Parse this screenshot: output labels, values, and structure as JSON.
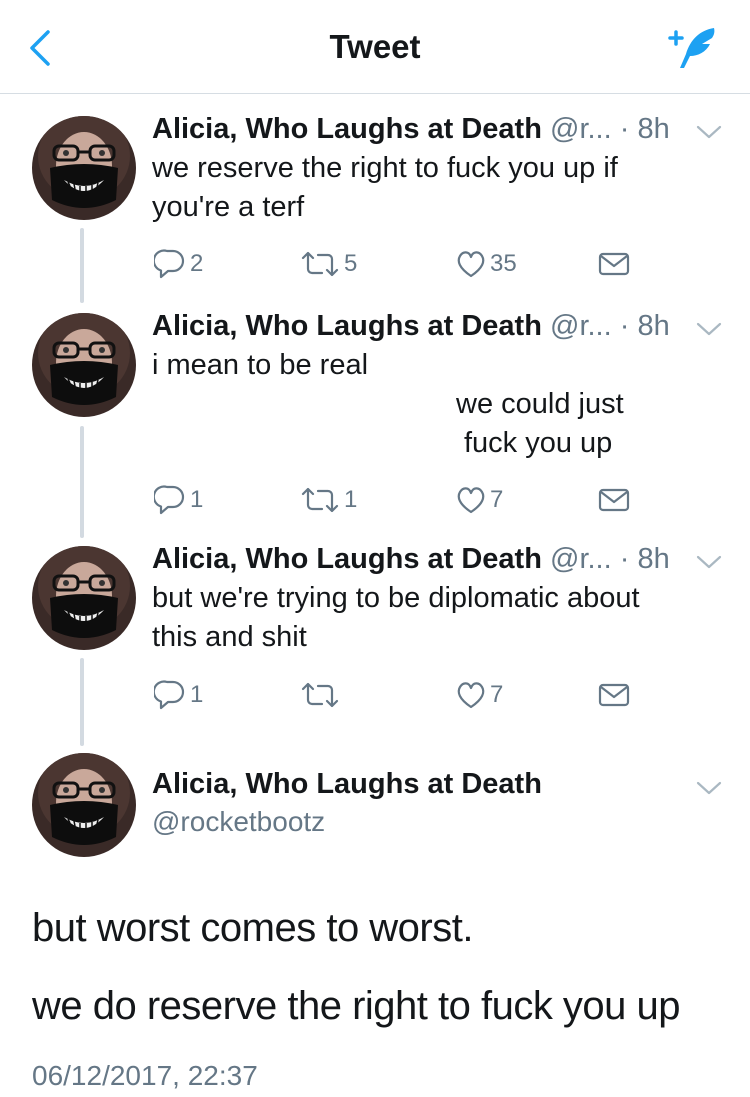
{
  "nav": {
    "title": "Tweet"
  },
  "tweets": [
    {
      "name": "Alicia, Who Laughs at Death",
      "handle": "@r...",
      "time": "· 8h",
      "lines": [
        "we reserve the right to fuck you up if",
        "you're a terf"
      ],
      "replies": "2",
      "retweets": "5",
      "likes": "35"
    },
    {
      "name": "Alicia, Who Laughs at Death",
      "handle": "@r...",
      "time": "· 8h",
      "lines": [
        "i mean to be real",
        "we could just",
        "fuck you up"
      ],
      "replies": "1",
      "retweets": "1",
      "likes": "7"
    },
    {
      "name": "Alicia, Who Laughs at Death",
      "handle": "@r...",
      "time": "· 8h",
      "lines": [
        "but we're trying to be diplomatic about",
        "this and shit"
      ],
      "replies": "1",
      "retweets": "",
      "likes": "7"
    }
  ],
  "main_tweet": {
    "name": "Alicia, Who Laughs at Death",
    "handle": "@rocketbootz",
    "lines": [
      "but worst comes to worst.",
      "we do reserve the right to fuck you up"
    ],
    "timestamp": "06/12/2017, 22:37"
  },
  "colors": {
    "accent": "#1da1f2",
    "secondary": "#657786",
    "divider": "#d6dde3",
    "text": "#14171a"
  }
}
